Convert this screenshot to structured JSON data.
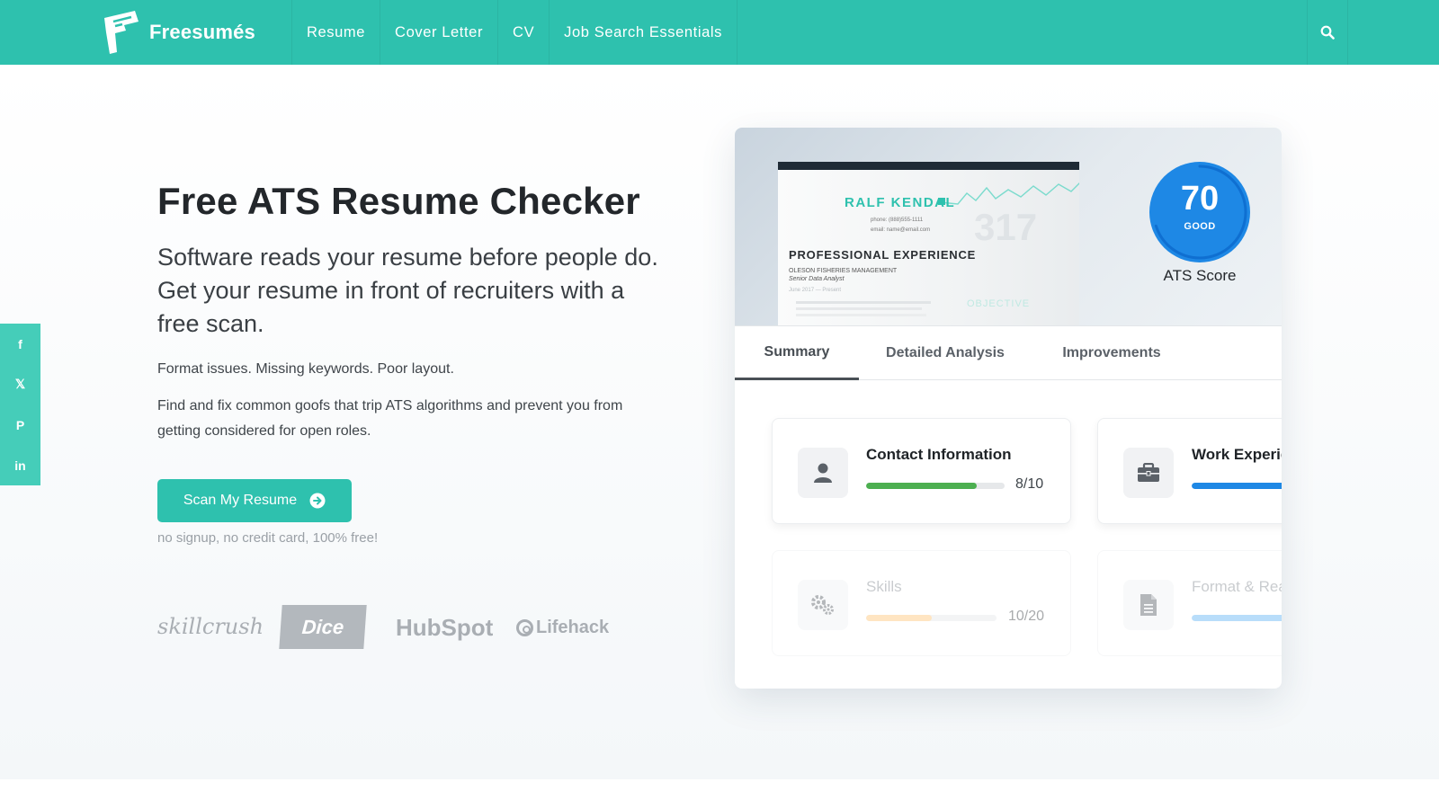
{
  "header": {
    "brand": "Freesumés",
    "nav": [
      {
        "label": "Resume"
      },
      {
        "label": "Cover Letter"
      },
      {
        "label": "CV"
      },
      {
        "label": "Job Search Essentials"
      }
    ],
    "search_icon": "search-icon",
    "bg_color": "#2ec1ae"
  },
  "share": {
    "buttons": [
      {
        "icon": "facebook-icon",
        "glyph": "f"
      },
      {
        "icon": "x-icon",
        "glyph": "𝕏"
      },
      {
        "icon": "pinterest-icon",
        "glyph": "P"
      },
      {
        "icon": "linkedin-icon",
        "glyph": "in"
      }
    ],
    "bg_color": "#45cdb9"
  },
  "hero": {
    "title": "Free ATS Resume Checker",
    "lead": "Software reads your resume before people do. Get your resume in front of recruiters with a free scan.",
    "p1": "Format issues. Missing keywords. Poor layout.",
    "p2": "Find and fix common goofs that trip ATS algorithms and prevent you from getting considered for open roles.",
    "cta_label": "Scan My Resume",
    "cta_note": "no signup, no credit card, 100% free!",
    "logos": {
      "skillcrush": "skillcrush",
      "dice": "Dice",
      "hubspot": "HubSpot",
      "lifehack": "Lifehack"
    }
  },
  "checker": {
    "resume_preview": {
      "name": "RALF KENDAL",
      "phone": "phone: (888)555-1111",
      "email": "email: name@email.com",
      "section": "PROFESSIONAL EXPERIENCE",
      "company": "OLESON FISHERIES MANAGEMENT",
      "role": "Senior Data Analyst",
      "dates": "June 2017 — Present",
      "objective": "OBJECTIVE"
    },
    "score": {
      "value": "70",
      "word": "GOOD",
      "label": "ATS Score",
      "fraction": 0.7,
      "color": "#1e88e5"
    },
    "tabs": [
      {
        "label": "Summary",
        "active": true
      },
      {
        "label": "Detailed Analysis",
        "active": false
      },
      {
        "label": "Improvements",
        "active": false
      }
    ],
    "tiles": [
      {
        "title": "Contact Information",
        "score": "8/10",
        "fraction": 0.8,
        "color": "#4caf50",
        "icon": "person-icon"
      },
      {
        "title": "Work Experience",
        "score": "",
        "fraction": 0.95,
        "color": "#1e88e5",
        "icon": "briefcase-icon"
      },
      {
        "title": "Skills",
        "score": "10/20",
        "fraction": 0.5,
        "color": "#ffc67a",
        "icon": "gears-icon"
      },
      {
        "title": "Format & Readability",
        "score": "",
        "fraction": 0.9,
        "color": "#64b5f6",
        "icon": "document-icon"
      }
    ]
  }
}
